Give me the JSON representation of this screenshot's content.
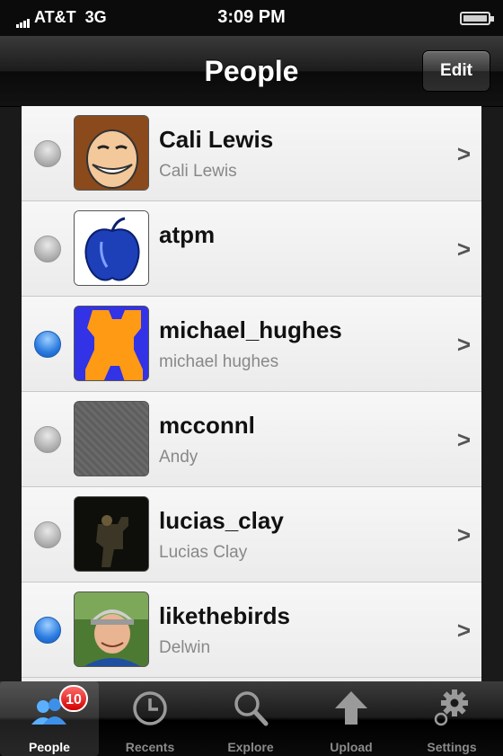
{
  "status_bar": {
    "carrier": "AT&T",
    "network": "3G",
    "time": "3:09 PM"
  },
  "nav": {
    "title": "People",
    "edit_label": "Edit"
  },
  "people": [
    {
      "name": "Cali Lewis",
      "subtitle": "Cali Lewis",
      "selected": false
    },
    {
      "name": "atpm",
      "subtitle": "",
      "selected": false
    },
    {
      "name": "michael_hughes",
      "subtitle": "michael hughes",
      "selected": true
    },
    {
      "name": "mcconnl",
      "subtitle": "Andy",
      "selected": false
    },
    {
      "name": "lucias_clay",
      "subtitle": "Lucias Clay",
      "selected": false
    },
    {
      "name": "likethebirds",
      "subtitle": "Delwin",
      "selected": true
    }
  ],
  "tabs": [
    {
      "label": "People",
      "icon": "people-icon",
      "badge": "10",
      "selected": true
    },
    {
      "label": "Recents",
      "icon": "clock-icon",
      "selected": false
    },
    {
      "label": "Explore",
      "icon": "search-icon",
      "selected": false
    },
    {
      "label": "Upload",
      "icon": "upload-arrow-icon",
      "selected": false
    },
    {
      "label": "Settings",
      "icon": "gear-icon",
      "selected": false
    }
  ]
}
